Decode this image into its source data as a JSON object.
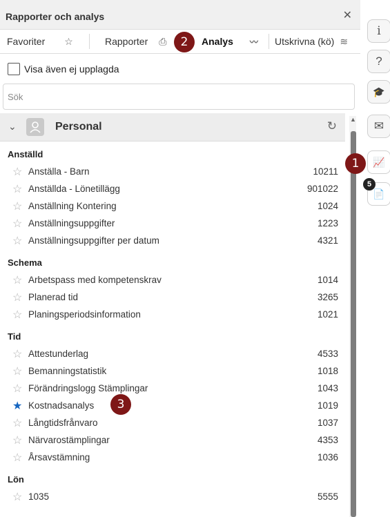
{
  "header": {
    "title": "Rapporter och analys",
    "close_icon": "close-icon"
  },
  "tabs": [
    {
      "label": "Favoriter",
      "icon": "star-icon",
      "glyph": "☆"
    },
    {
      "label": "Rapporter",
      "icon": "printer-icon",
      "glyph": "⎙"
    },
    {
      "label": "Analys",
      "icon": "chart-icon",
      "glyph": "〰"
    },
    {
      "label": "Utskrivna (kö)",
      "icon": "layers-icon",
      "glyph": "≋"
    }
  ],
  "callouts": [
    "1",
    "2",
    "3"
  ],
  "checkbox_label": "Visa även ej upplagda",
  "search": {
    "placeholder": "Sök"
  },
  "group": {
    "title": "Personal"
  },
  "sections": [
    {
      "title": "Anställd",
      "items": [
        {
          "label": "Anställa - Barn",
          "count": "10211"
        },
        {
          "label": "Anställda - Lönetillägg",
          "count": "901022"
        },
        {
          "label": "Anställning Kontering",
          "count": "1024"
        },
        {
          "label": "Anställningsuppgifter",
          "count": "1223"
        },
        {
          "label": "Anställningsuppgifter per datum",
          "count": "4321"
        }
      ]
    },
    {
      "title": "Schema",
      "items": [
        {
          "label": "Arbetspass med kompetenskrav",
          "count": "1014"
        },
        {
          "label": "Planerad tid",
          "count": "3265"
        },
        {
          "label": "Planingsperiodsinformation",
          "count": "1021"
        }
      ]
    },
    {
      "title": "Tid",
      "items": [
        {
          "label": "Attestunderlag",
          "count": "4533"
        },
        {
          "label": "Bemanningstatistik",
          "count": "1018"
        },
        {
          "label": "Förändringslogg Stämplingar",
          "count": "1043"
        },
        {
          "label": "Kostnadsanalys",
          "count": "1019",
          "favorite": true
        },
        {
          "label": "Långtidsfrånvaro",
          "count": "1037"
        },
        {
          "label": "Närvarostämplingar",
          "count": "4353"
        },
        {
          "label": "Årsavstämning",
          "count": "1036"
        }
      ]
    },
    {
      "title": "Lön",
      "items": [
        {
          "label": "1035",
          "count": "5555"
        }
      ]
    }
  ],
  "sidebar": {
    "buttons": [
      {
        "name": "info-button",
        "glyph": "i"
      },
      {
        "name": "help-button",
        "glyph": "?"
      },
      {
        "name": "education-button",
        "glyph": "🎓"
      },
      {
        "name": "mail-button",
        "glyph": "✉"
      },
      {
        "name": "report-button",
        "glyph": "📈"
      },
      {
        "name": "document-button",
        "glyph": "📄"
      }
    ],
    "notification_count": "5"
  },
  "colors": {
    "accent_badge": "#7e1717",
    "favorite_star": "#1565c0",
    "panel_header_bg": "#f0f0f0"
  }
}
